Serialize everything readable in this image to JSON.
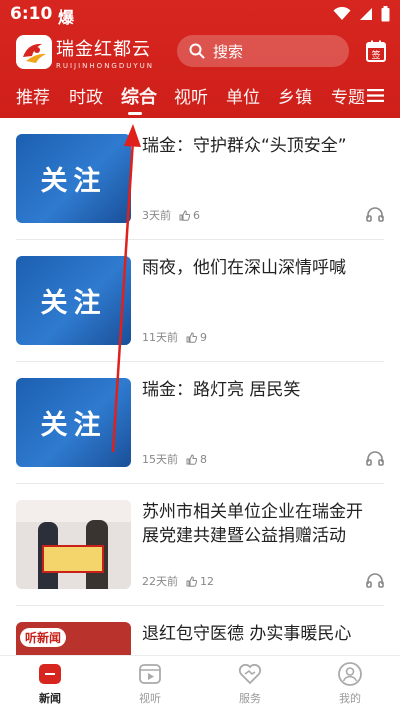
{
  "status_bar": {
    "time": "6:10",
    "notification": "爆"
  },
  "header": {
    "brand_name": "瑞金红都云",
    "brand_sub": "RUIJINHONGDUYUN",
    "search_placeholder": "搜索",
    "signin_label": "签",
    "accent_color": "#d7261f"
  },
  "tabs": [
    {
      "label": "推荐"
    },
    {
      "label": "时政"
    },
    {
      "label": "综合",
      "active": true
    },
    {
      "label": "视听"
    },
    {
      "label": "单位"
    },
    {
      "label": "乡镇"
    },
    {
      "label": "专题"
    }
  ],
  "articles": [
    {
      "title": "瑞金：守护群众“头顶安全”",
      "time": "3天前",
      "likes": "6",
      "thumb_text": "关注"
    },
    {
      "title": "雨夜，他们在深山深情呼喊",
      "time": "11天前",
      "likes": "9",
      "thumb_text": "关注"
    },
    {
      "title": "瑞金：路灯亮 居民笑",
      "time": "15天前",
      "likes": "8",
      "thumb_text": "关注"
    },
    {
      "title": "苏州市相关单位企业在瑞金开展党建共建暨公益捐赠活动",
      "time": "22天前",
      "likes": "12"
    },
    {
      "title": "退红包守医德 办实事暖民心",
      "thumb_text": "听新闻"
    }
  ],
  "bottom_nav": [
    {
      "label": "新闻",
      "icon": "news-icon",
      "active": true
    },
    {
      "label": "视听",
      "icon": "video-icon"
    },
    {
      "label": "服务",
      "icon": "service-icon"
    },
    {
      "label": "我的",
      "icon": "profile-icon"
    }
  ]
}
